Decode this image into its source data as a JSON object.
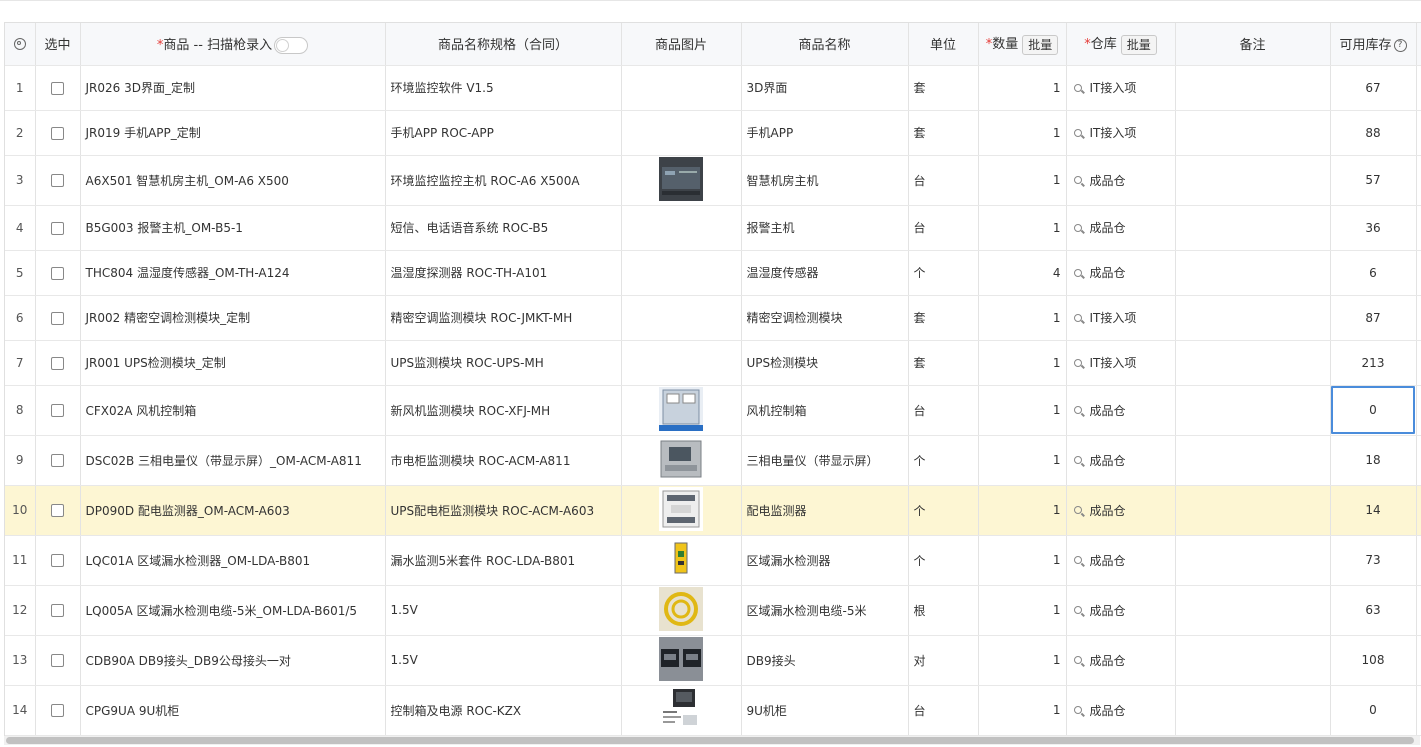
{
  "header": {
    "select": "选中",
    "product": "商品 -- 扫描枪录入",
    "spec": "商品名称规格（合同）",
    "image": "商品图片",
    "name": "商品名称",
    "unit": "单位",
    "qty": "数量",
    "warehouse": "仓库",
    "batch": "批量",
    "remark": "备注",
    "stock": "可用库存",
    "help": "?"
  },
  "rows": [
    {
      "index": "1",
      "product": "JR026 3D界面_定制",
      "spec": "环境监控软件 V1.5",
      "image": "",
      "name": "3D界面",
      "unit": "套",
      "qty": "1",
      "warehouse": "IT接入项",
      "remark": "",
      "stock": "67"
    },
    {
      "index": "2",
      "product": "JR019 手机APP_定制",
      "spec": "手机APP ROC-APP",
      "image": "",
      "name": "手机APP",
      "unit": "套",
      "qty": "1",
      "warehouse": "IT接入项",
      "remark": "",
      "stock": "88"
    },
    {
      "index": "3",
      "product": "A6X501 智慧机房主机_OM-A6 X500",
      "spec": "环境监控监控主机 ROC-A6 X500A",
      "image": "host-device",
      "name": "智慧机房主机",
      "unit": "台",
      "qty": "1",
      "warehouse": "成品仓",
      "remark": "",
      "stock": "57"
    },
    {
      "index": "4",
      "product": "B5G003 报警主机_OM-B5-1",
      "spec": "短信、电话语音系统 ROC-B5",
      "image": "",
      "name": "报警主机",
      "unit": "台",
      "qty": "1",
      "warehouse": "成品仓",
      "remark": "",
      "stock": "36"
    },
    {
      "index": "5",
      "product": "THC804 温湿度传感器_OM-TH-A124",
      "spec": "温湿度探测器 ROC-TH-A101",
      "image": "",
      "name": "温湿度传感器",
      "unit": "个",
      "qty": "4",
      "warehouse": "成品仓",
      "remark": "",
      "stock": "6"
    },
    {
      "index": "6",
      "product": "JR002 精密空调检测模块_定制",
      "spec": "精密空调监测模块 ROC-JMKT-MH",
      "image": "",
      "name": "精密空调检测模块",
      "unit": "套",
      "qty": "1",
      "warehouse": "IT接入项",
      "remark": "",
      "stock": "87"
    },
    {
      "index": "7",
      "product": "JR001 UPS检测模块_定制",
      "spec": "UPS监测模块 ROC-UPS-MH",
      "image": "",
      "name": "UPS检测模块",
      "unit": "套",
      "qty": "1",
      "warehouse": "IT接入项",
      "remark": "",
      "stock": "213"
    },
    {
      "index": "8",
      "product": "CFX02A 风机控制箱",
      "spec": "新风机监测模块 ROC-XFJ-MH",
      "image": "control-box",
      "name": "风机控制箱",
      "unit": "台",
      "qty": "1",
      "warehouse": "成品仓",
      "remark": "",
      "stock": "0"
    },
    {
      "index": "9",
      "product": "DSC02B 三相电量仪（带显示屏）_OM-ACM-A811",
      "spec": "市电柜监测模块 ROC-ACM-A811",
      "image": "power-meter",
      "name": "三相电量仪（带显示屏）",
      "unit": "个",
      "qty": "1",
      "warehouse": "成品仓",
      "remark": "",
      "stock": "18"
    },
    {
      "index": "10",
      "product": "DP090D 配电监测器_OM-ACM-A603",
      "spec": "UPS配电柜监测模块 ROC-ACM-A603",
      "image": "power-monitor",
      "name": "配电监测器",
      "unit": "个",
      "qty": "1",
      "warehouse": "成品仓",
      "remark": "",
      "stock": "14"
    },
    {
      "index": "11",
      "product": "LQC01A 区域漏水检测器_OM-LDA-B801",
      "spec": "漏水监测5米套件 ROC-LDA-B801",
      "image": "leak-detector",
      "name": "区域漏水检测器",
      "unit": "个",
      "qty": "1",
      "warehouse": "成品仓",
      "remark": "",
      "stock": "73"
    },
    {
      "index": "12",
      "product": "LQ005A 区域漏水检测电缆-5米_OM-LDA-B601/5",
      "spec": "1.5V",
      "image": "leak-cable",
      "name": "区域漏水检测电缆-5米",
      "unit": "根",
      "qty": "1",
      "warehouse": "成品仓",
      "remark": "",
      "stock": "63"
    },
    {
      "index": "13",
      "product": "CDB90A DB9接头_DB9公母接头一对",
      "spec": "1.5V",
      "image": "db9-connector",
      "name": "DB9接头",
      "unit": "对",
      "qty": "1",
      "warehouse": "成品仓",
      "remark": "",
      "stock": "108"
    },
    {
      "index": "14",
      "product": "CPG9UA 9U机柜",
      "spec": "控制箱及电源 ROC-KZX",
      "image": "cabinet",
      "name": "9U机柜",
      "unit": "台",
      "qty": "1",
      "warehouse": "成品仓",
      "remark": "",
      "stock": "0"
    }
  ],
  "state": {
    "highlighted_row": "10",
    "selected_cell_row": "8",
    "selected_cell_column": "stock"
  },
  "colors": {
    "highlight_row": "#fdf6d3",
    "selected_border": "#4a8cdb",
    "required_mark": "#e53935",
    "header_bg": "#f7f8fa"
  },
  "icons": {
    "settings": "gear-icon",
    "search": "search-icon",
    "toggle": "scan-toggle",
    "help": "help-icon"
  }
}
